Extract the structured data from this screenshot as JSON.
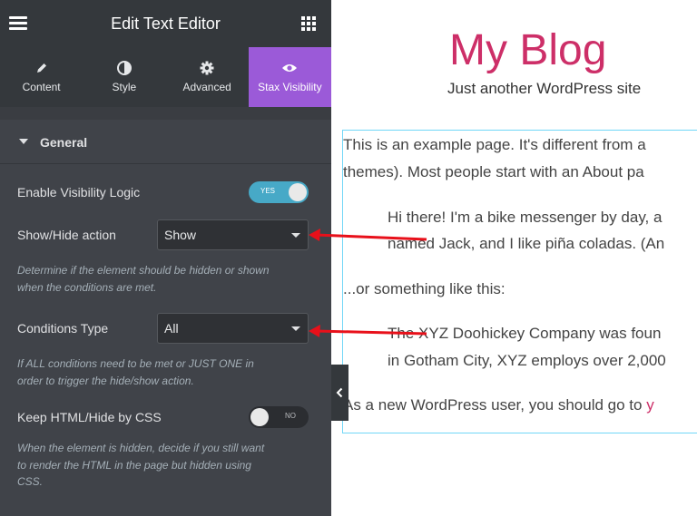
{
  "panel": {
    "title": "Edit Text Editor",
    "tabs": [
      {
        "label": "Content",
        "icon": "pencil-icon"
      },
      {
        "label": "Style",
        "icon": "half-circle-icon"
      },
      {
        "label": "Advanced",
        "icon": "gear-icon"
      },
      {
        "label": "Stax Visibility",
        "icon": "eye-icon",
        "active": true
      }
    ],
    "section": {
      "title": "General",
      "expanded": true
    },
    "controls": {
      "enable_logic": {
        "label": "Enable Visibility Logic",
        "state": "YES"
      },
      "show_hide": {
        "label": "Show/Hide action",
        "value": "Show",
        "description": [
          "Determine if the element should be hidden or shown",
          "when the conditions are met."
        ]
      },
      "conditions_type": {
        "label": "Conditions Type",
        "value": "All",
        "description": [
          "If ALL conditions need to be met or JUST ONE in",
          "order to trigger the hide/show action."
        ]
      },
      "keep_html": {
        "label": "Keep HTML/Hide by CSS",
        "state": "NO",
        "description": [
          "When the element is hidden, decide if you still want",
          "to render the HTML in the page but hidden using",
          "CSS."
        ]
      }
    }
  },
  "preview": {
    "site_title": "My Blog",
    "tagline": "Just another WordPress site",
    "paragraphs": [
      "This is an example page. It's different from a",
      "themes). Most people start with an About pa"
    ],
    "quote1": [
      "Hi there! I'm a bike messenger by day, a",
      "named Jack, and I like piña coladas. (An"
    ],
    "middle": "...or something like this:",
    "quote2": [
      "The XYZ Doohickey Company was foun",
      "in Gotham City, XYZ employs over 2,000"
    ],
    "last_line": "As a new WordPress user, you should go to ",
    "link_fragment": "y"
  },
  "colors": {
    "panel_bg": "#404349",
    "active_tab": "#9b5ad8",
    "switch_on": "#47a9c7",
    "brand_pink": "#cd2f68",
    "arrow_red": "#e8101a",
    "content_border": "#71d7f7"
  }
}
